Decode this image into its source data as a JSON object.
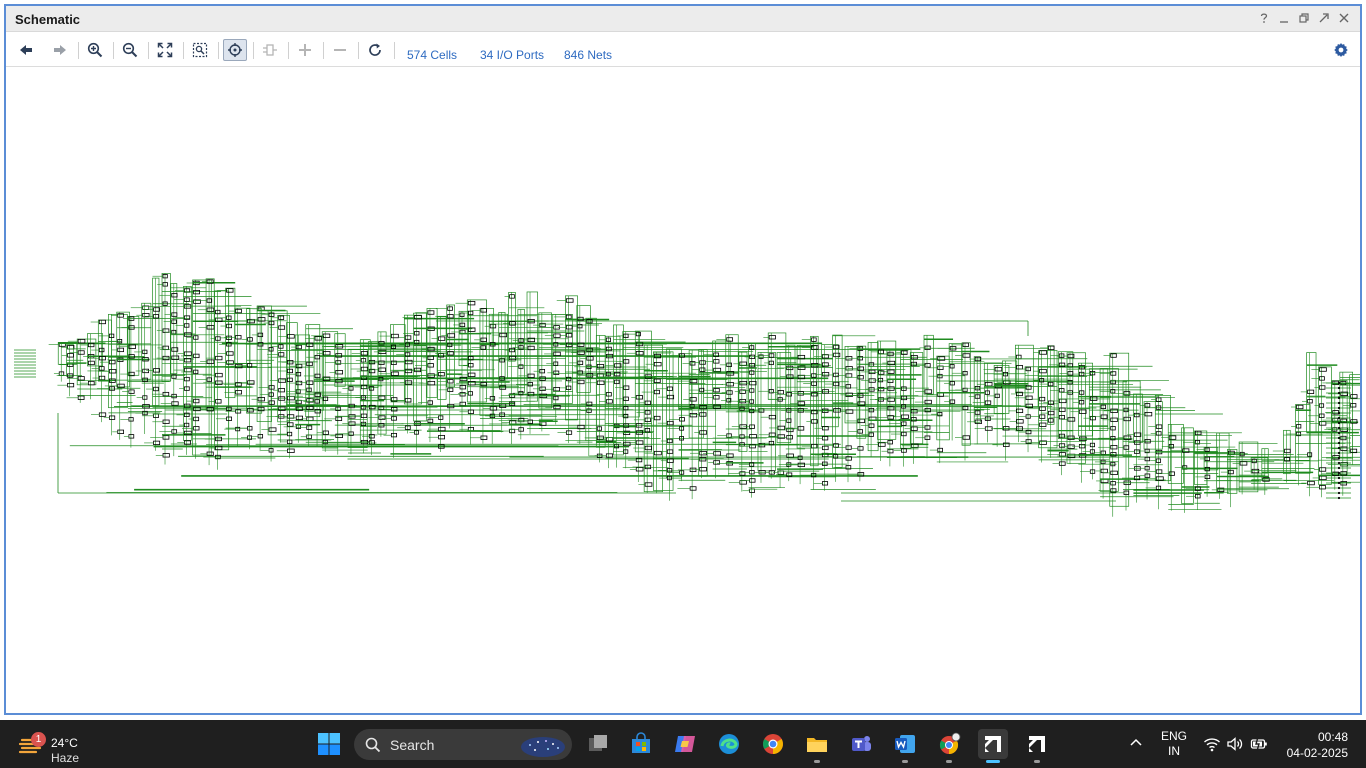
{
  "window": {
    "title": "Schematic",
    "controls": [
      "help-icon",
      "minimize-icon",
      "restore-icon",
      "float-icon",
      "close-icon"
    ]
  },
  "toolbar": {
    "buttons": [
      "back-icon",
      "forward-icon",
      "zoom-in-icon",
      "zoom-out-icon",
      "zoom-fit-icon",
      "zoom-selection-icon",
      "auto-fit-icon",
      "expand-cell-icon",
      "expand-icon",
      "collapse-icon",
      "refresh-icon"
    ],
    "stats": {
      "cells": "574 Cells",
      "io_ports": "34 I/O Ports",
      "nets": "846 Nets"
    },
    "accent": "#2e6bc1"
  },
  "schematic": {
    "wire_color": "#1f8b1f",
    "cell_color": "#000000"
  },
  "taskbar": {
    "weather": {
      "badge": "1",
      "temp": "24°C",
      "desc": "Haze"
    },
    "search_label": "Search",
    "apps": [
      "task-view-icon",
      "store-icon",
      "copilot-icon",
      "edge-icon",
      "chrome-icon",
      "file-explorer-icon",
      "teams-icon",
      "word-icon",
      "chrome-profile-icon",
      "vivado-icon",
      "vivado-2-icon"
    ],
    "lang": {
      "line1": "ENG",
      "line2": "IN"
    },
    "clock": {
      "time": "00:48",
      "date": "04-02-2025"
    }
  }
}
